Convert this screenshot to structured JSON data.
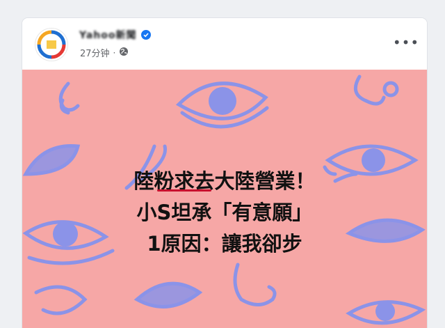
{
  "post": {
    "author_name": "Yahoo新聞",
    "verified": true,
    "timestamp": "27分钟",
    "separator": "·",
    "audience_icon": "globe-icon",
    "more_label": "•••"
  },
  "image": {
    "headline_line1": "陸粉求去大陸營業！",
    "headline_line2": "小S坦承「有意願」",
    "headline_line3": "1原因：讓我卻步",
    "background_color": "#f6a7a6",
    "illustration_color": "#8b93e8"
  }
}
